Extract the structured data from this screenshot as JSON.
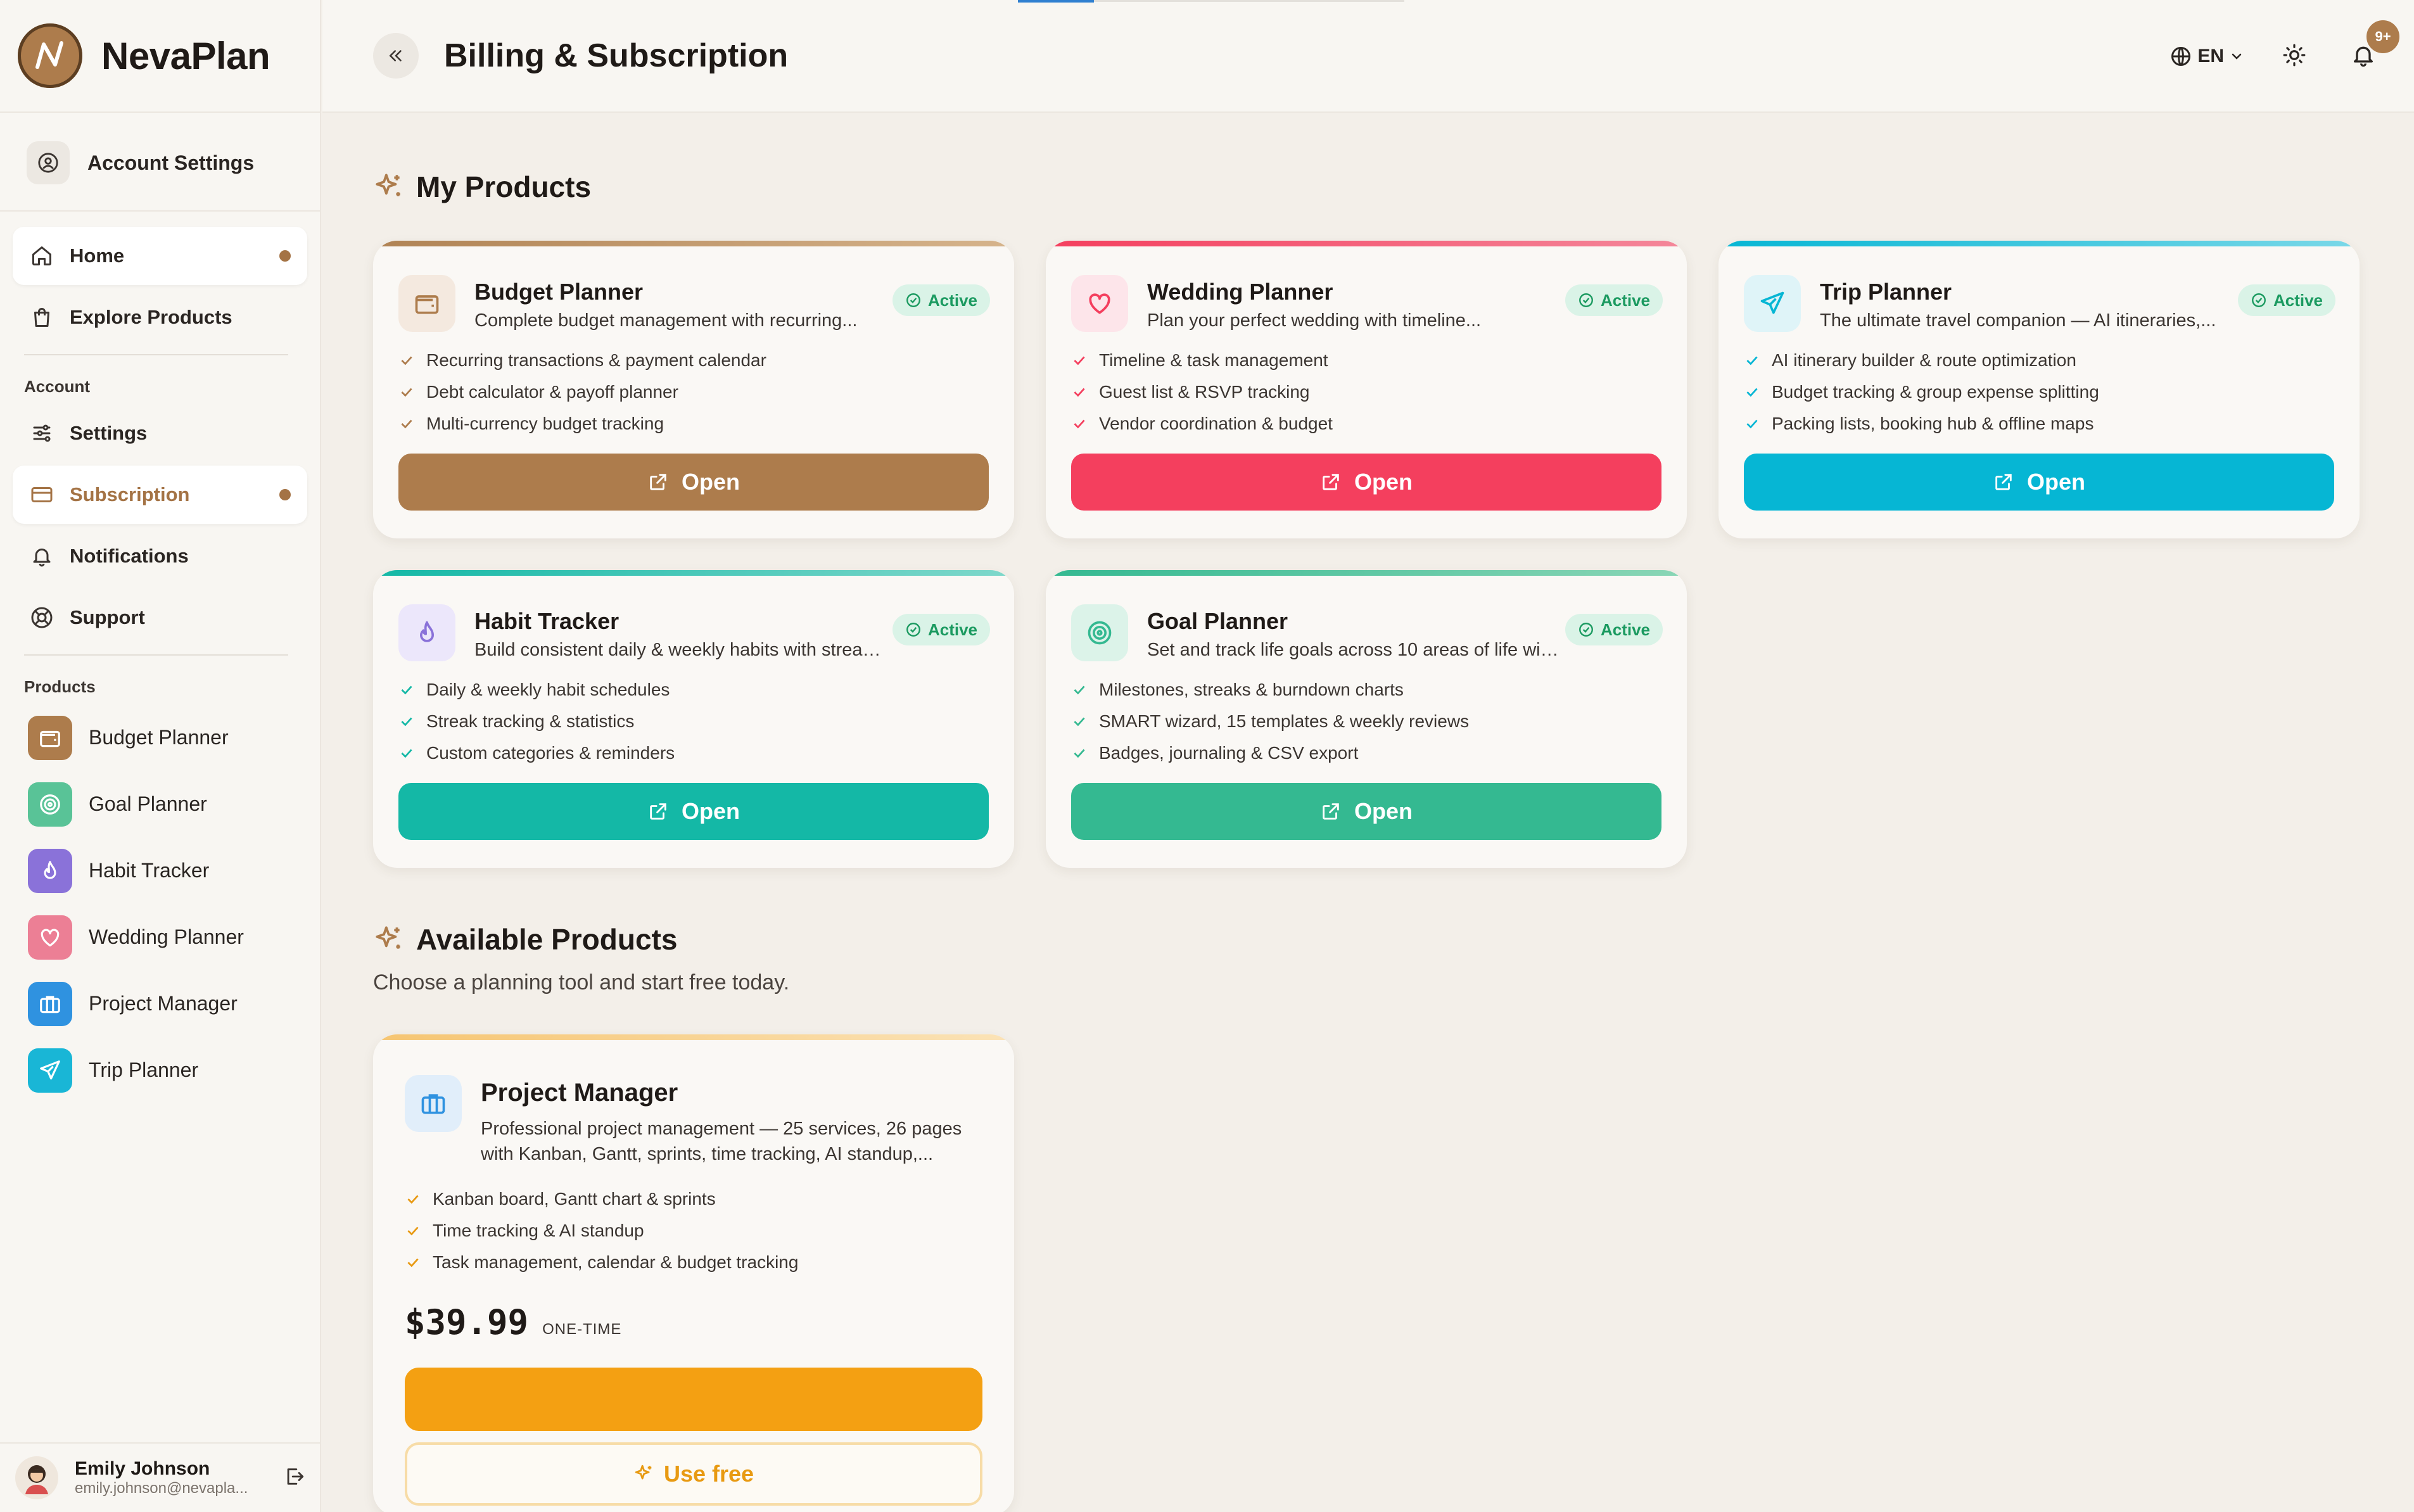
{
  "brand": {
    "name": "NevaPlan"
  },
  "sidebar": {
    "account_settings": "Account Settings",
    "nav_main": [
      {
        "label": "Home",
        "active": true
      },
      {
        "label": "Explore Products",
        "active": false
      }
    ],
    "account_section": "Account",
    "nav_account": [
      {
        "label": "Settings"
      },
      {
        "label": "Subscription",
        "active": true
      },
      {
        "label": "Notifications"
      },
      {
        "label": "Support"
      }
    ],
    "products_section": "Products",
    "products": [
      {
        "label": "Budget Planner",
        "icon": "wallet-icon",
        "color": "#ad7c4c"
      },
      {
        "label": "Goal Planner",
        "icon": "target-icon",
        "color": "#59c397"
      },
      {
        "label": "Habit Tracker",
        "icon": "flame-icon",
        "color": "#8a72d9"
      },
      {
        "label": "Wedding Planner",
        "icon": "heart-icon",
        "color": "#ec7f95"
      },
      {
        "label": "Project Manager",
        "icon": "briefcase-icon",
        "color": "#2f92e0"
      },
      {
        "label": "Trip Planner",
        "icon": "plane-icon",
        "color": "#19b6d6"
      }
    ],
    "user": {
      "name": "Emily Johnson",
      "email": "emily.johnson@nevapla..."
    }
  },
  "header": {
    "title": "Billing & Subscription",
    "language": "EN",
    "notification_count": "9+"
  },
  "my_products": {
    "title": "My Products",
    "cards": [
      {
        "name": "Budget Planner",
        "description": "Complete budget management with recurring...",
        "status": "Active",
        "features": [
          "Recurring transactions & payment calendar",
          "Debt calculator & payoff planner",
          "Multi-currency budget tracking"
        ],
        "button": "Open",
        "color": "#ad7c4c"
      },
      {
        "name": "Wedding Planner",
        "description": "Plan your perfect wedding with timeline...",
        "status": "Active",
        "features": [
          "Timeline & task management",
          "Guest list & RSVP tracking",
          "Vendor coordination & budget"
        ],
        "button": "Open",
        "color": "#f43f5e"
      },
      {
        "name": "Trip Planner",
        "description": "The ultimate travel companion — AI itineraries,...",
        "status": "Active",
        "features": [
          "AI itinerary builder & route optimization",
          "Budget tracking & group expense splitting",
          "Packing lists, booking hub & offline maps"
        ],
        "button": "Open",
        "color": "#06b6d4"
      },
      {
        "name": "Habit Tracker",
        "description": "Build consistent daily & weekly habits with streak...",
        "status": "Active",
        "features": [
          "Daily & weekly habit schedules",
          "Streak tracking & statistics",
          "Custom categories & reminders"
        ],
        "button": "Open",
        "color": "#14b8a6"
      },
      {
        "name": "Goal Planner",
        "description": "Set and track life goals across 10 areas of life wit...",
        "status": "Active",
        "features": [
          "Milestones, streaks & burndown charts",
          "SMART wizard, 15 templates & weekly reviews",
          "Badges, journaling & CSV export"
        ],
        "button": "Open",
        "color": "#34b991"
      }
    ]
  },
  "available_products": {
    "title": "Available Products",
    "subtitle": "Choose a planning tool and start free today.",
    "cards": [
      {
        "name": "Project Manager",
        "description": "Professional project management — 25 services, 26 pages with Kanban, Gantt, sprints, time tracking, AI standup,...",
        "features": [
          "Kanban board, Gantt chart & sprints",
          "Time tracking & AI standup",
          "Task management, calendar & budget tracking"
        ],
        "price": "$39.99",
        "price_note": "ONE-TIME",
        "free_button": "Use free",
        "color": "#f4a012"
      }
    ]
  }
}
